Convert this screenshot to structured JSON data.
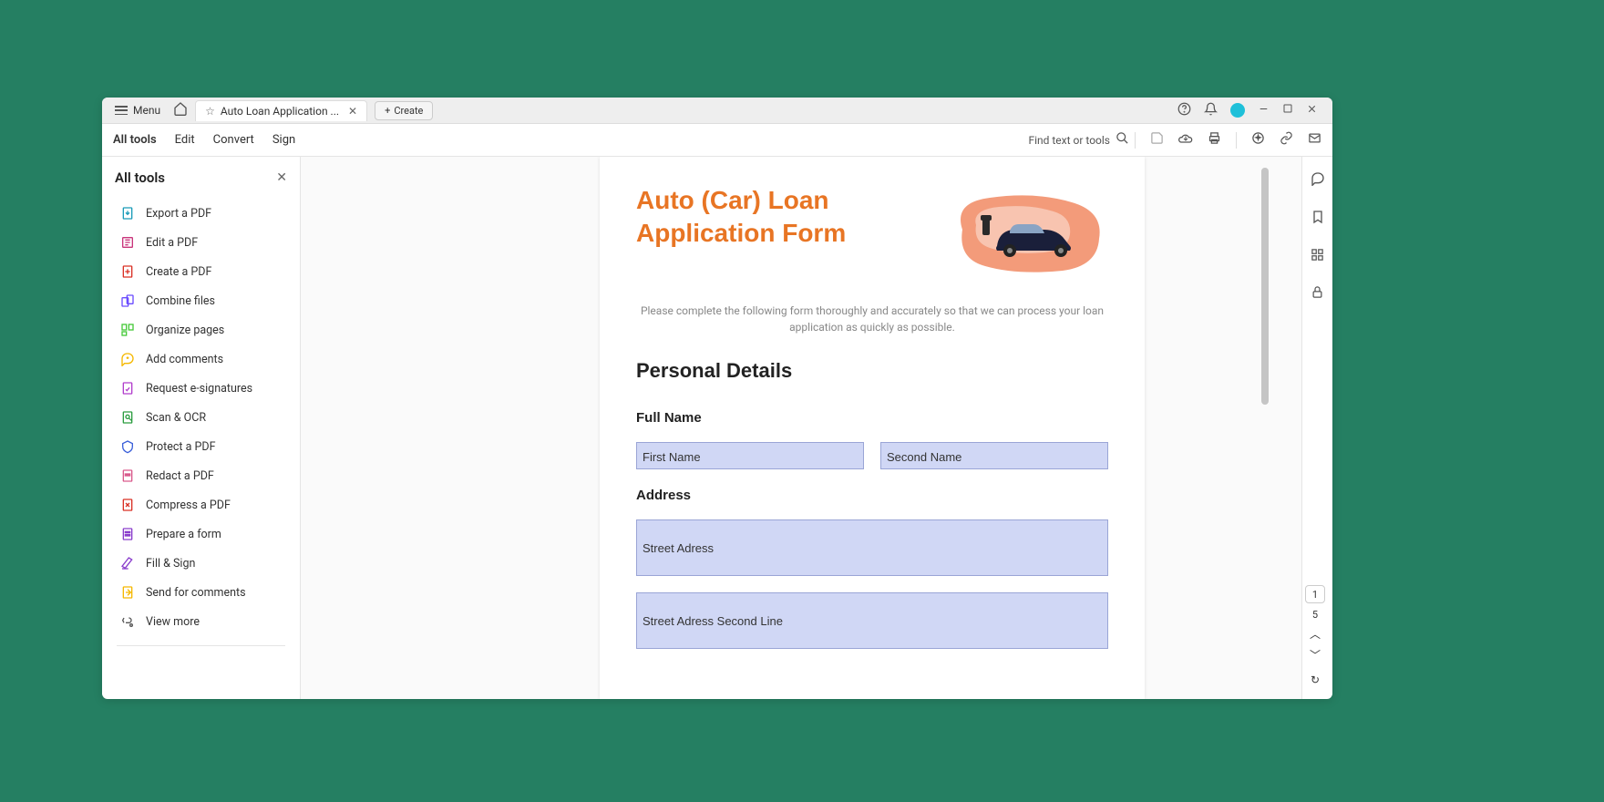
{
  "titlebar": {
    "menu_label": "Menu",
    "tab_title": "Auto Loan Application ...",
    "create_label": "Create"
  },
  "subbar": {
    "tabs": [
      "All tools",
      "Edit",
      "Convert",
      "Sign"
    ],
    "find_label": "Find text or tools"
  },
  "sidebar": {
    "title": "All tools",
    "items": [
      {
        "label": "Export a PDF",
        "color": "#1a9bb8"
      },
      {
        "label": "Edit a PDF",
        "color": "#c9347b"
      },
      {
        "label": "Create a PDF",
        "color": "#d93025"
      },
      {
        "label": "Combine files",
        "color": "#6a4cff"
      },
      {
        "label": "Organize pages",
        "color": "#47c93a"
      },
      {
        "label": "Add comments",
        "color": "#f5b800"
      },
      {
        "label": "Request e-signatures",
        "color": "#b13dcc"
      },
      {
        "label": "Scan & OCR",
        "color": "#2a9c3f"
      },
      {
        "label": "Protect a PDF",
        "color": "#3a5fd9"
      },
      {
        "label": "Redact a PDF",
        "color": "#d95a8c"
      },
      {
        "label": "Compress a PDF",
        "color": "#d93025"
      },
      {
        "label": "Prepare a form",
        "color": "#8a3dcc"
      },
      {
        "label": "Fill & Sign",
        "color": "#8a3dcc"
      },
      {
        "label": "Send for comments",
        "color": "#f5b800"
      },
      {
        "label": "View more",
        "color": "#555"
      }
    ]
  },
  "document": {
    "title": "Auto (Car) Loan Application Form",
    "description": "Please complete the following form thoroughly and accurately so that we can process your loan application as quickly as possible.",
    "section1": "Personal Details",
    "full_name_label": "Full Name",
    "first_name_placeholder": "First Name",
    "second_name_placeholder": "Second Name",
    "address_label": "Address",
    "street_placeholder": "Street Adress",
    "street2_placeholder": "Street Adress Second Line"
  },
  "page_nav": {
    "current": "1",
    "total": "5"
  }
}
